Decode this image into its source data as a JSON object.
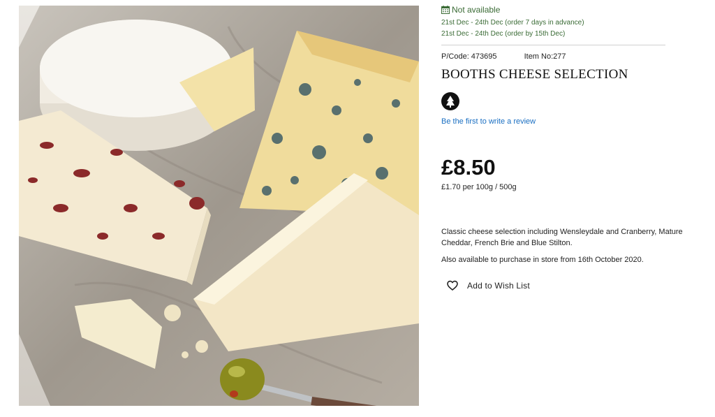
{
  "availability": {
    "status": "Not available",
    "icon": "calendar-icon",
    "status_color": "#3a6b35",
    "windows": [
      "21st Dec - 24th Dec (order 7 days in advance)",
      "21st Dec - 24th Dec (order by 15th Dec)"
    ]
  },
  "product": {
    "pcode": "P/Code: 473695",
    "item_no": "Item No:277",
    "title": "BOOTHS CHEESE SELECTION",
    "badge_icon": "vegetarian-tree-icon",
    "review_link": "Be the first to write a review",
    "price": "£8.50",
    "unit_price": "£1.70 per 100g /  500g",
    "description": "Classic cheese selection including Wensleydale and Cranberry, Mature Cheddar, French Brie and Blue Stilton.",
    "store_note": "Also available to purchase in store from 16th October 2020.",
    "image_icon": "cheese-selection-photo"
  },
  "wishlist": {
    "icon": "heart-icon",
    "label": "Add to Wish List"
  },
  "colors": {
    "link": "#1a6fc2",
    "text": "#222222"
  }
}
